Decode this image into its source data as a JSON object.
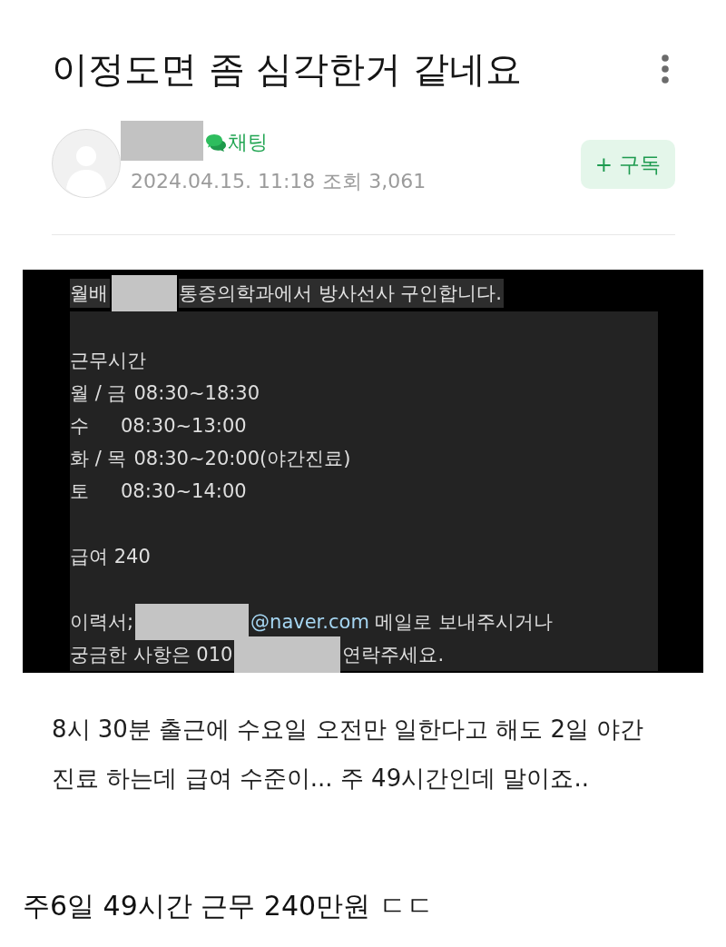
{
  "title": "이정도면 좀 심각한거 같네요",
  "author": {
    "name": {
      "kind": "redacted"
    },
    "chat_label": "채팅",
    "date": "2024.04.15. 11:18",
    "views": "조회 3,061"
  },
  "subscribe_button": "+ 구독",
  "posting_image": {
    "headline": [
      {
        "kind": "text",
        "text": "월배"
      },
      {
        "kind": "redacted"
      },
      {
        "kind": "text",
        "text": "통증의학과에서 방사선사 구인합니다."
      }
    ],
    "hours_heading": "근무시간",
    "schedule": [
      {
        "day": "월 / 금",
        "hours": "08:30~18:30"
      },
      {
        "day": "수",
        "hours": "08:30~13:00"
      },
      {
        "day": "화 / 목",
        "hours": "08:30~20:00(야간진료)"
      },
      {
        "day": "토",
        "hours": "08:30~14:00"
      }
    ],
    "pay": "급여 240",
    "contact_lines": [
      {
        "parts": [
          {
            "kind": "text",
            "text": "이력서;"
          },
          {
            "kind": "redacted"
          },
          {
            "kind": "email",
            "text": "@naver.com"
          },
          {
            "kind": "text",
            "text": "메일로 보내주시거나"
          }
        ]
      },
      {
        "parts": [
          {
            "kind": "text",
            "text": "궁금한 사항은 010"
          },
          {
            "kind": "redacted"
          },
          {
            "kind": "text",
            "text": "연락주세요."
          }
        ]
      }
    ]
  },
  "body_paragraph": {
    "lines": [
      "8시 30분 출근에 수요일 오전만 일한다고 해도 2일 야간",
      "진료 하는데 급여 수준이... 주 49시간인데 말이죠.."
    ]
  },
  "closing_line": "주6일 49시간 근무 240만원 ㄷㄷ"
}
